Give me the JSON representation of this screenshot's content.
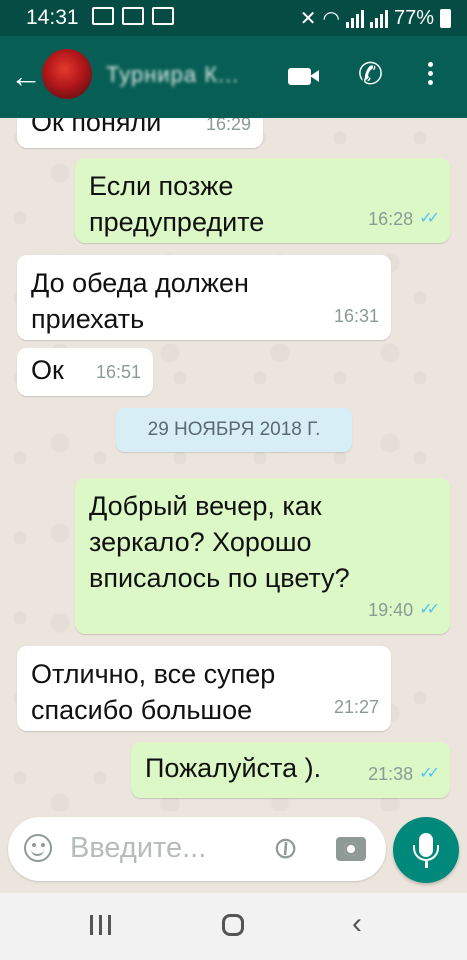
{
  "status_bar": {
    "time": "14:31",
    "battery": "77%"
  },
  "header": {
    "back_glyph": "←",
    "contact_name": "Турнира К...",
    "icons": [
      "video-call-icon",
      "phone-icon",
      "more-vert-icon"
    ]
  },
  "messages": [
    {
      "dir": "in",
      "text": "Ок поняли",
      "time": "16:29"
    },
    {
      "dir": "out",
      "text": "Если позже\nпредупредите",
      "time": "16:28",
      "ticks": "✓✓"
    },
    {
      "dir": "in",
      "text": "До обеда должен\nприехать",
      "time": "16:31"
    },
    {
      "dir": "in",
      "text": "Ок",
      "time": "16:51"
    },
    {
      "dir": "out",
      "text": "Добрый вечер, как\nзеркало? Хорошо\nвписалось по цвету?",
      "time": "19:40",
      "ticks": "✓✓"
    },
    {
      "dir": "in",
      "text": "Отлично, все супер\nспасибо большое",
      "time": "21:27"
    },
    {
      "dir": "out",
      "text": "Пожалуйста ).",
      "time": "21:38",
      "ticks": "✓✓"
    }
  ],
  "date_divider": "29 НОЯБРЯ 2018 Г.",
  "input": {
    "placeholder": "Введите..."
  },
  "colors": {
    "header": "#075e54",
    "outgoing": "#dcf8c6",
    "incoming": "#ffffff",
    "ticks": "#4fc3f7",
    "fab": "#00897b"
  }
}
